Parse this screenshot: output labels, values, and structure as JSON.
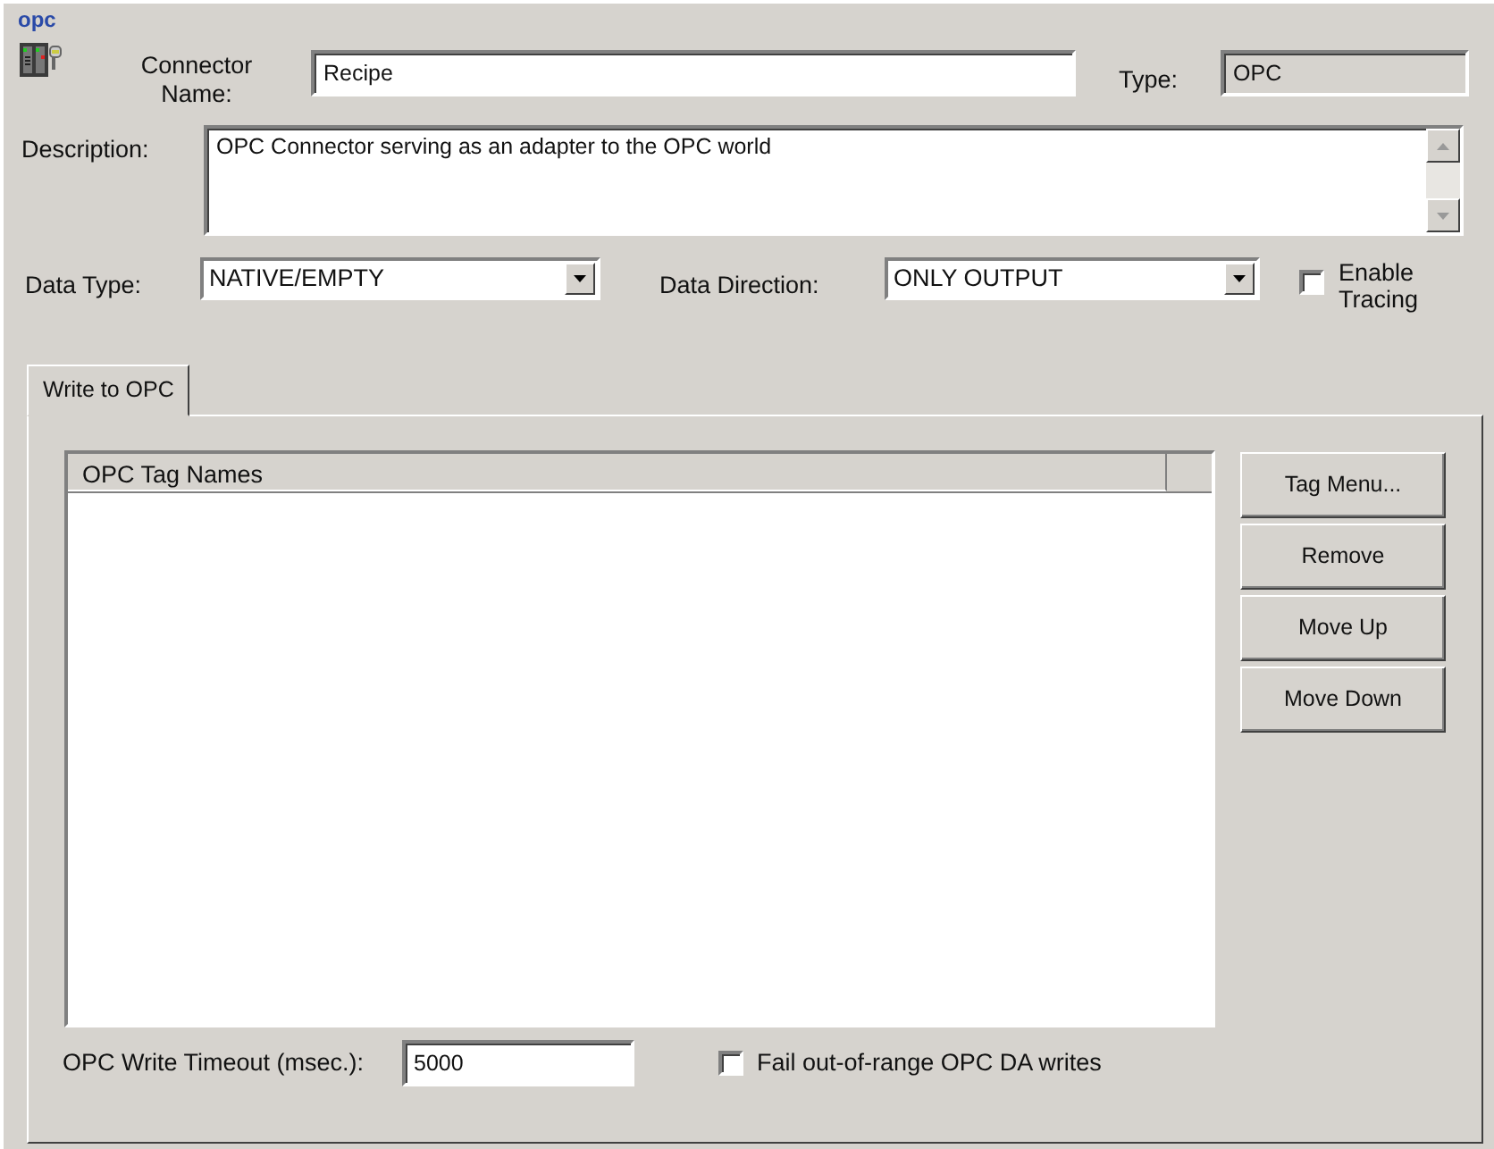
{
  "header": {
    "logo_text": "opc"
  },
  "connector_name": {
    "label": "Connector Name:",
    "value": "Recipe"
  },
  "type": {
    "label": "Type:",
    "value": "OPC",
    "disabled": true
  },
  "description": {
    "label": "Description:",
    "value": "OPC Connector serving as an adapter to the OPC world"
  },
  "data_type": {
    "label": "Data Type:",
    "value": "NATIVE/EMPTY"
  },
  "data_direction": {
    "label": "Data Direction:",
    "value": "ONLY OUTPUT"
  },
  "enable_tracing": {
    "label": "Enable Tracing",
    "checked": false
  },
  "tabs": [
    {
      "label": "Write to OPC",
      "selected": true
    }
  ],
  "tag_list": {
    "columns": [
      "OPC Tag Names"
    ]
  },
  "buttons": [
    "Tag Menu...",
    "Remove",
    "Move Up",
    "Move Down"
  ],
  "timeout": {
    "label": "OPC Write Timeout (msec.):",
    "value": "5000"
  },
  "fail_out_of_range": {
    "label": "Fail out-of-range OPC DA writes",
    "checked": false
  }
}
